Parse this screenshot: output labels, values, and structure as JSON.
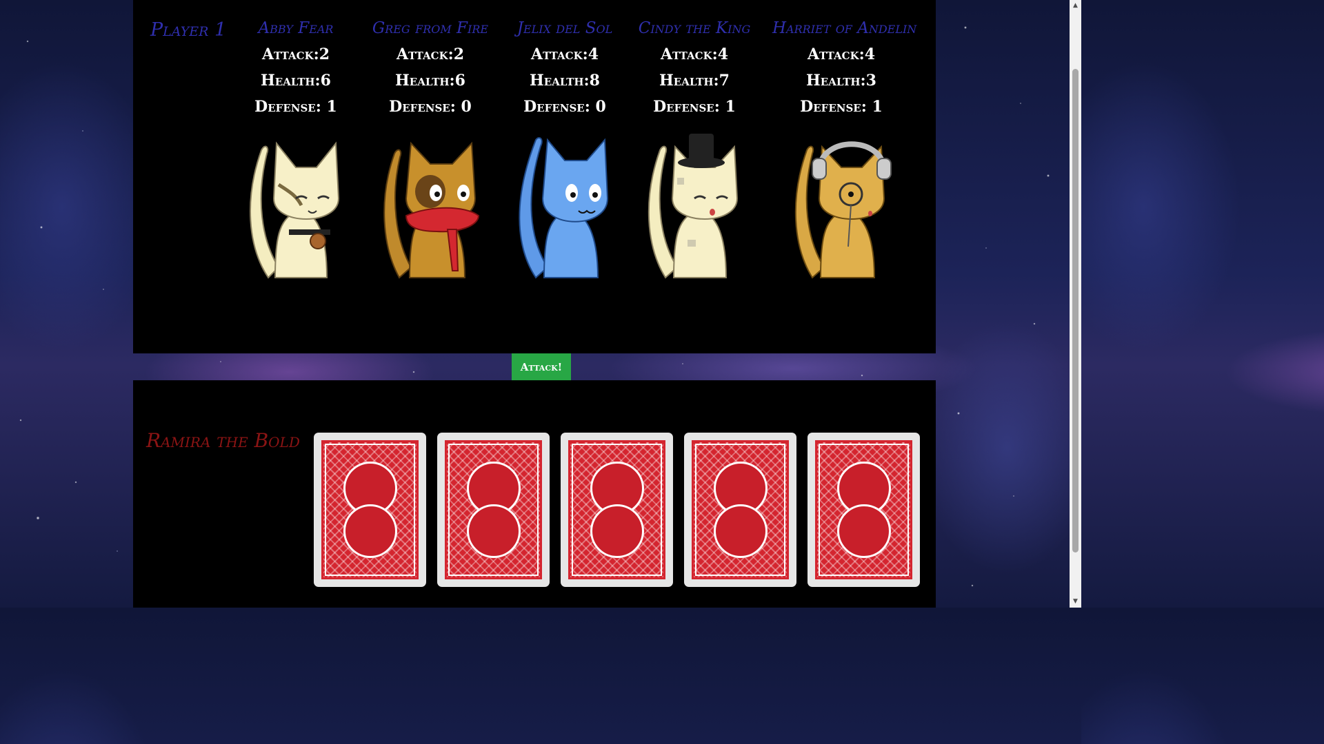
{
  "player_label": "Player 1",
  "units": [
    {
      "name": "Abby Fear",
      "attack_text": "Attack:2",
      "health_text": "Health:6",
      "defense_text": "Defense: 1",
      "icon": "cream-tabby-cat-with-bell-collar-icon"
    },
    {
      "name": "Greg from Fire",
      "attack_text": "Attack:2",
      "health_text": "Health:6",
      "defense_text": "Defense: 0",
      "icon": "orange-cat-with-red-scarf-icon"
    },
    {
      "name": "Jelix del Sol",
      "attack_text": "Attack:4",
      "health_text": "Health:8",
      "defense_text": "Defense: 0",
      "icon": "blue-cat-icon"
    },
    {
      "name": "Cindy the King",
      "attack_text": "Attack:4",
      "health_text": "Health:7",
      "defense_text": "Defense: 1",
      "icon": "cream-cat-with-top-hat-icon"
    },
    {
      "name": "Harriet of Andelin",
      "attack_text": "Attack:4",
      "health_text": "Health:3",
      "defense_text": "Defense: 1",
      "icon": "orange-cat-with-headphones-and-monocle-icon"
    }
  ],
  "attack_button_label": "Attack!",
  "enemy": {
    "name": "Ramira the Bold",
    "cards": [
      "card-back-icon",
      "card-back-icon",
      "card-back-icon",
      "card-back-icon",
      "card-back-icon"
    ]
  },
  "colors": {
    "player_blue": "#2f2fae",
    "enemy_red": "#8b1414",
    "attack_green": "#28a745",
    "card_red": "#d4252f"
  }
}
